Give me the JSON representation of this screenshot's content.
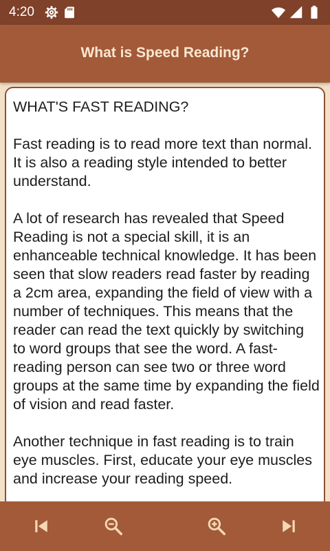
{
  "status_bar": {
    "time": "4:20",
    "icons": [
      "settings-gear-icon",
      "sd-card-icon",
      "wifi-icon",
      "cellular-signal-icon",
      "battery-icon"
    ]
  },
  "app_bar": {
    "title": "What is Speed Reading?"
  },
  "content": {
    "text": "WHAT'S FAST READING?\n\nFast reading is to read more text than normal. It is also a reading style intended to better understand.\n\nA lot of research has revealed that Speed Reading is not a special skill, it is an enhanceable technical knowledge. It has been seen that slow readers read faster by reading a 2cm area, expanding the field of view with a number of techniques. This means that the reader can read the text quickly by switching to word groups that see the word. A fast-reading person can see two or three word groups at the same time by expanding the field of vision and read faster.\n\nAnother technique in fast reading is to train eye muscles. First, educate your eye muscles and increase your reading speed."
  },
  "bottom_bar": {
    "buttons": [
      "skip-previous-icon",
      "zoom-out-icon",
      "zoom-in-icon",
      "skip-next-icon"
    ]
  },
  "colors": {
    "status_bar": "#7f412a",
    "app_bar": "#a25a39",
    "title_text": "#fbe7d0",
    "background": "#f3e1c7",
    "card_border": "#8c5035",
    "bottom_icons": "#f6d7b4"
  }
}
